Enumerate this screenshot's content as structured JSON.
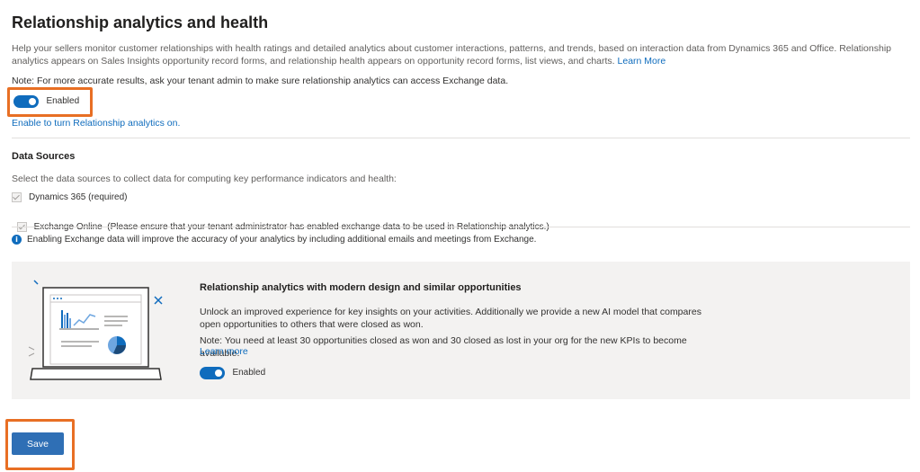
{
  "page": {
    "title": "Relationship analytics and health",
    "description": "Help your sellers monitor customer relationships with health ratings and detailed analytics about customer interactions, patterns, and trends, based on interaction data from Dynamics 365 and Office. Relationship analytics appears on Sales Insights opportunity record forms, and relationship health appears on opportunity record forms, list views, and charts.",
    "learn_more": "Learn More",
    "note": "Note: For more accurate results, ask your tenant admin to make sure relationship analytics can access Exchange data."
  },
  "main_toggle": {
    "label": "Enabled",
    "on": true
  },
  "enable_link": "Enable to turn Relationship analytics on.",
  "data_sources": {
    "heading": "Data Sources",
    "instruction": "Select the data sources to collect data for computing key performance indicators and health:",
    "items": [
      {
        "label": "Dynamics 365 (required)",
        "checked": true
      },
      {
        "label": "Exchange Online  (Please ensure that your tenant administrator has enabled exchange data to be used in Relationship analytics.)",
        "checked": true
      }
    ],
    "info": "Enabling Exchange data will improve the accuracy of your analytics by including additional emails and meetings from Exchange."
  },
  "promo": {
    "title": "Relationship analytics with modern design and similar opportunities",
    "body": "Unlock an improved experience for key insights on your activities. Additionally we provide a new AI model that compares open opportunities to others that were closed as won.",
    "note": "Note: You need at least 30 opportunities closed as won and 30 closed as lost in your org for the new KPIs to become available.",
    "learn_more": "Learn more",
    "toggle_label": "Enabled",
    "illustration": "laptop-analytics-illustration"
  },
  "save_label": "Save",
  "colors": {
    "accent": "#0f6cbd",
    "highlight": "#e86f24",
    "panel": "#f3f2f1"
  }
}
